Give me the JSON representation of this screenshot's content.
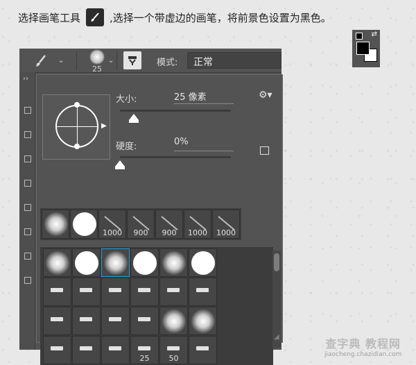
{
  "instruction": {
    "part1": "选择画笔工具",
    "part2": ",选择一个带虚边的画笔，将前景色设置为黑色。",
    "tool_icon": "brush-icon"
  },
  "color_swatch": {
    "foreground": "#000000",
    "background": "#ffffff"
  },
  "options_bar": {
    "brush_size_preview": "25",
    "mode_label": "模式:",
    "mode_value": "正常"
  },
  "brush_popup": {
    "size_label": "大小:",
    "size_value": "25 像素",
    "size_percent": 0.08,
    "hardness_label": "硬度:",
    "hardness_value": "0%",
    "hardness_percent": 0.0
  },
  "recent_brushes": [
    {
      "type": "soft",
      "label": ""
    },
    {
      "type": "hard",
      "label": ""
    },
    {
      "type": "stroke",
      "label": "1000"
    },
    {
      "type": "stroke",
      "label": "900"
    },
    {
      "type": "stroke",
      "label": "900"
    },
    {
      "type": "stroke",
      "label": "1000"
    },
    {
      "type": "stroke",
      "label": "1000"
    }
  ],
  "presets": [
    {
      "type": "soft",
      "label": ""
    },
    {
      "type": "hard",
      "label": ""
    },
    {
      "type": "soft",
      "label": "",
      "selected": true
    },
    {
      "type": "hard",
      "label": ""
    },
    {
      "type": "soft",
      "label": ""
    },
    {
      "type": "hard",
      "label": ""
    },
    {
      "type": "tip",
      "label": ""
    },
    {
      "type": "tip",
      "label": ""
    },
    {
      "type": "tip",
      "label": ""
    },
    {
      "type": "tip",
      "label": ""
    },
    {
      "type": "tip",
      "label": ""
    },
    {
      "type": "tip",
      "label": ""
    },
    {
      "type": "tip",
      "label": ""
    },
    {
      "type": "tip",
      "label": ""
    },
    {
      "type": "tip",
      "label": ""
    },
    {
      "type": "tip",
      "label": ""
    },
    {
      "type": "soft",
      "label": ""
    },
    {
      "type": "soft",
      "label": ""
    },
    {
      "type": "tip",
      "label": ""
    },
    {
      "type": "tip",
      "label": ""
    },
    {
      "type": "tip",
      "label": ""
    },
    {
      "type": "tip",
      "label": "25"
    },
    {
      "type": "tip",
      "label": "50"
    },
    {
      "type": "tip",
      "label": ""
    }
  ],
  "watermark": {
    "line1": "查字典 教程网",
    "line2": "jiaocheng.chazidian.com"
  }
}
